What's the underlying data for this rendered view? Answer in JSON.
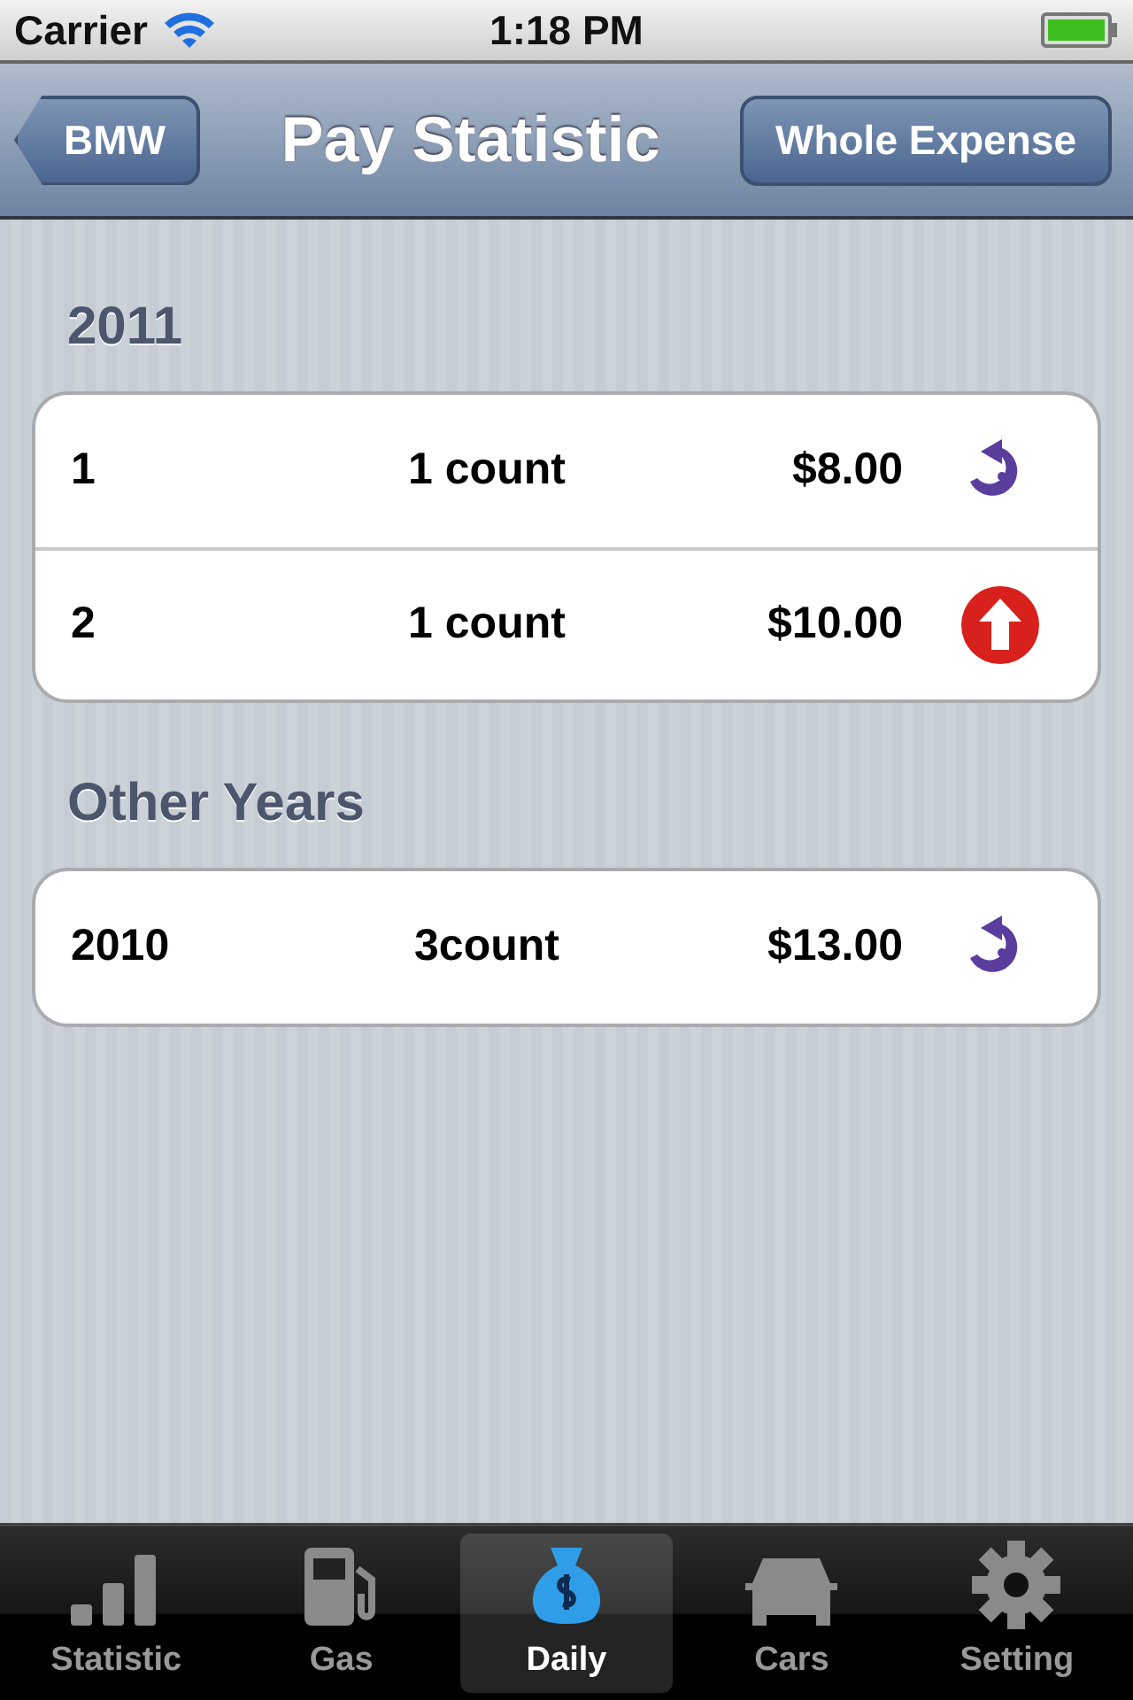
{
  "status_bar": {
    "carrier": "Carrier",
    "time": "1:18 PM"
  },
  "nav_bar": {
    "back": "BMW",
    "title": "Pay Statistic",
    "right_button": "Whole Expense"
  },
  "sections": [
    {
      "header": "2011",
      "rows": [
        {
          "period": "1",
          "count": "1 count",
          "amount": "$8.00",
          "kind": "undo"
        },
        {
          "period": "2",
          "count": "1 count",
          "amount": "$10.00",
          "kind": "up"
        }
      ]
    },
    {
      "header": "Other Years",
      "rows": [
        {
          "period": "2010",
          "count": "3count",
          "amount": "$13.00",
          "kind": "undo"
        }
      ]
    }
  ],
  "tab_bar": [
    {
      "label": "Statistic",
      "kind": "chart",
      "selected": false
    },
    {
      "label": "Gas",
      "kind": "pump",
      "selected": false
    },
    {
      "label": "Daily",
      "kind": "bag",
      "selected": true
    },
    {
      "label": "Cars",
      "kind": "car",
      "selected": false
    },
    {
      "label": "Setting",
      "kind": "gear",
      "selected": false
    }
  ]
}
